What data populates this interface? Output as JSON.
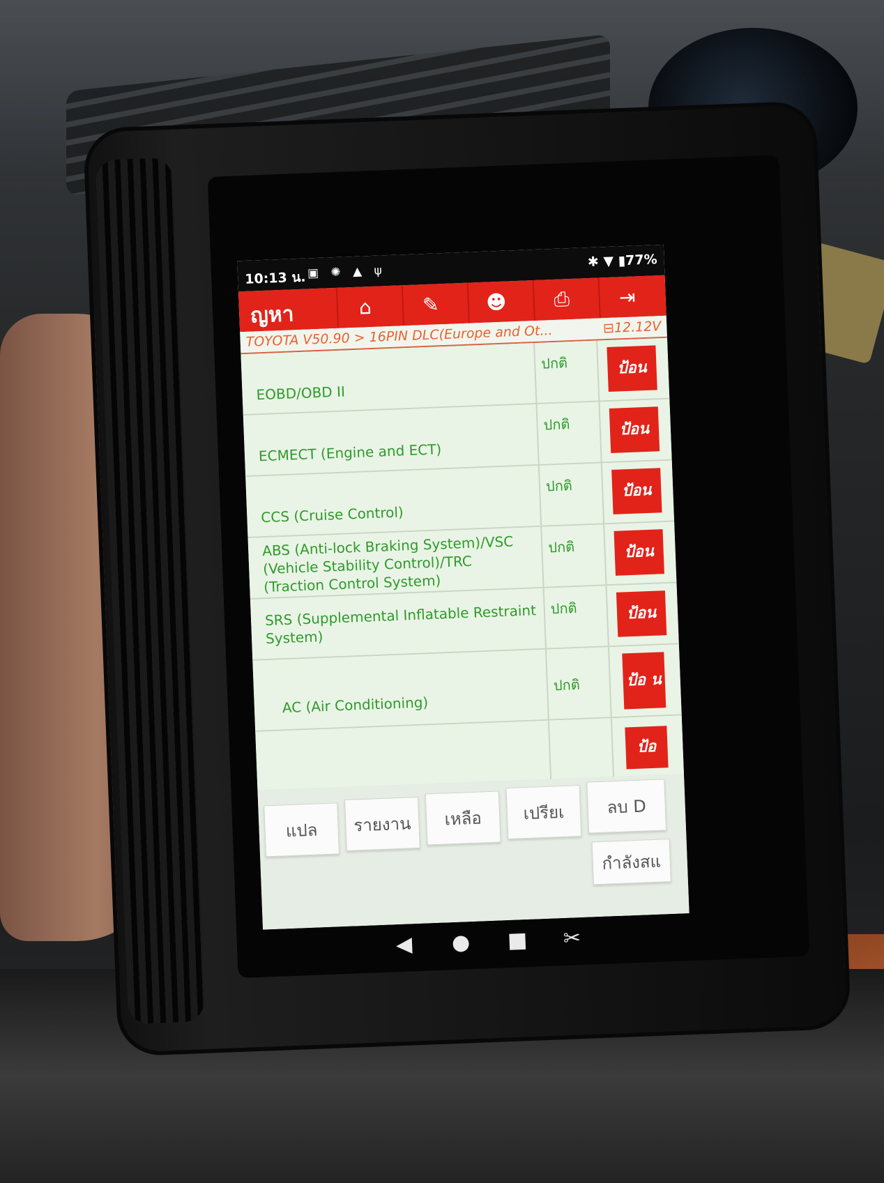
{
  "status_bar": {
    "time": "10:13 น.",
    "icons": [
      "calendar-icon",
      "settings-icon",
      "warning-icon",
      "usb-icon"
    ],
    "right_icons": [
      "bluetooth-icon",
      "wifi-icon",
      "battery-icon"
    ],
    "battery": "77%"
  },
  "app_bar": {
    "title": "ญหา",
    "buttons": [
      {
        "icon": "home-icon",
        "glyph": "⌂"
      },
      {
        "icon": "edit-icon",
        "glyph": "✎"
      },
      {
        "icon": "user-icon",
        "glyph": "☻"
      },
      {
        "icon": "printer-icon",
        "glyph": "⎙"
      },
      {
        "icon": "exit-icon",
        "glyph": "⇥"
      }
    ]
  },
  "breadcrumb": {
    "path": "TOYOTA V50.90 > 16PIN DLC(Europe and Ot...",
    "voltage": "12.12V"
  },
  "systems": [
    {
      "name": "EOBD/OBD II",
      "status": "ปกติ",
      "action": "ป้อน"
    },
    {
      "name": "ECMECT (Engine and ECT)",
      "status": "ปกติ",
      "action": "ป้อน"
    },
    {
      "name": "CCS (Cruise Control)",
      "status": "ปกติ",
      "action": "ป้อน"
    },
    {
      "name": "ABS (Anti-lock Braking System)/VSC (Vehicle Stability Control)/TRC (Traction Control System)",
      "status": "ปกติ",
      "action": "ป้อน"
    },
    {
      "name": "SRS (Supplemental Inflatable Restraint System)",
      "status": "ปกติ",
      "action": "ป้อน"
    },
    {
      "name": "AC (Air Conditioning)",
      "status": "ปกติ",
      "action": "ป้อ น"
    },
    {
      "name": "",
      "status": "",
      "action": "ป้อ"
    }
  ],
  "bottom_buttons": [
    "แปล",
    "รายงาน",
    "เหลือ",
    "เปรียเ",
    "ลบ D",
    "กำลังสแ"
  ],
  "nav": {
    "back": "◀",
    "home": "●",
    "recents": "■",
    "screenshot": "✂"
  },
  "colors": {
    "accent": "#e2231a",
    "text_green": "#2f9a2a",
    "background": "#e9f4e6"
  }
}
